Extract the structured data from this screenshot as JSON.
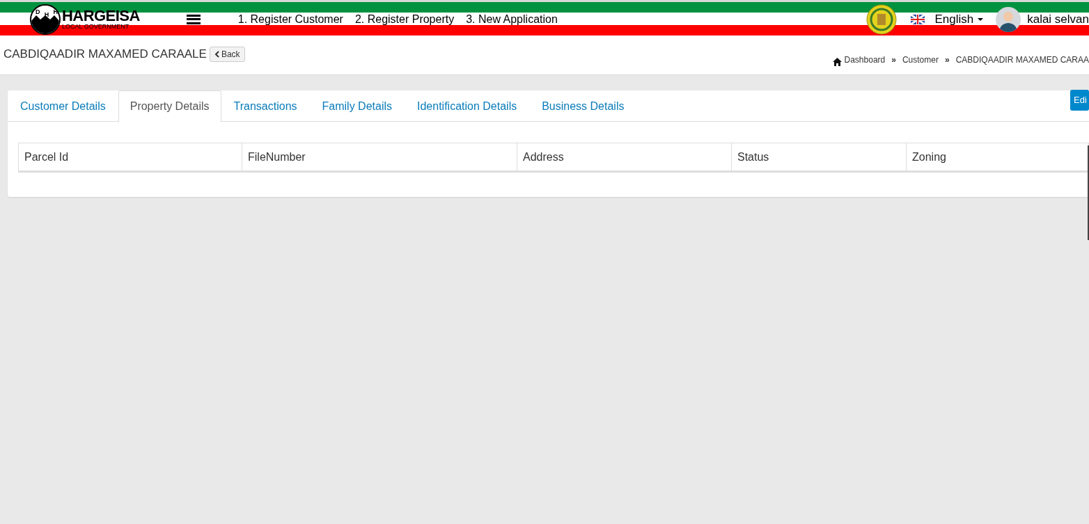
{
  "brand": {
    "emblem_letters": [
      "D",
      "H",
      "H"
    ],
    "name": "HARGEISA",
    "subtitle": "LOCAL GOVERNMENT"
  },
  "nav_links": [
    "1. Register Customer",
    "2. Register Property",
    "3. New Application"
  ],
  "language": "English",
  "user": {
    "name": "kalai selvan"
  },
  "page": {
    "title": "CABDIQAADIR MAXAMED CARAALE",
    "back_label": "Back"
  },
  "breadcrumb": [
    "Dashboard",
    "Customer",
    "CABDIQAADIR MAXAMED CARAA"
  ],
  "breadcrumb_separators": [
    "»",
    "»"
  ],
  "edit_label": "Edi",
  "tabs": [
    {
      "label": "Customer Details",
      "selected": false
    },
    {
      "label": "Property Details",
      "selected": true
    },
    {
      "label": "Transactions",
      "selected": false
    },
    {
      "label": "Family Details",
      "selected": false
    },
    {
      "label": "Identification Details",
      "selected": false
    },
    {
      "label": "Business Details",
      "selected": false
    }
  ],
  "table": {
    "columns": [
      "Parcel Id",
      "FileNumber",
      "Address",
      "Status",
      "Zoning"
    ]
  }
}
